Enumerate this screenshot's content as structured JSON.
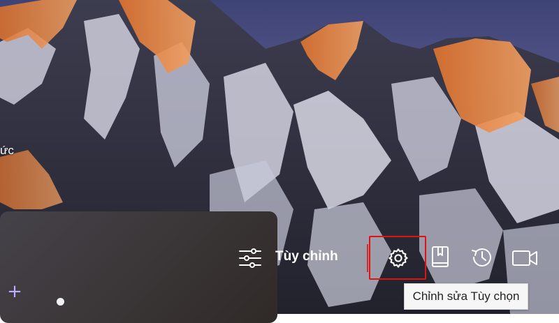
{
  "background": {
    "partial_left_text": "ức"
  },
  "panel": {
    "add_symbol": "+"
  },
  "toolbar": {
    "customize_label": "Tùy chỉnh",
    "icons": {
      "customize": "sliders-icon",
      "settings": "gear-icon",
      "bookmarks": "bookmark-book-icon",
      "history": "history-clock-icon",
      "video": "video-camera-icon"
    }
  },
  "tooltip": {
    "text": "Chỉnh sửa Tùy chọn"
  },
  "colors": {
    "highlight": "#e01212",
    "accent_plus": "#b9b0ff",
    "tooltip_bg": "#f6f6f6"
  }
}
